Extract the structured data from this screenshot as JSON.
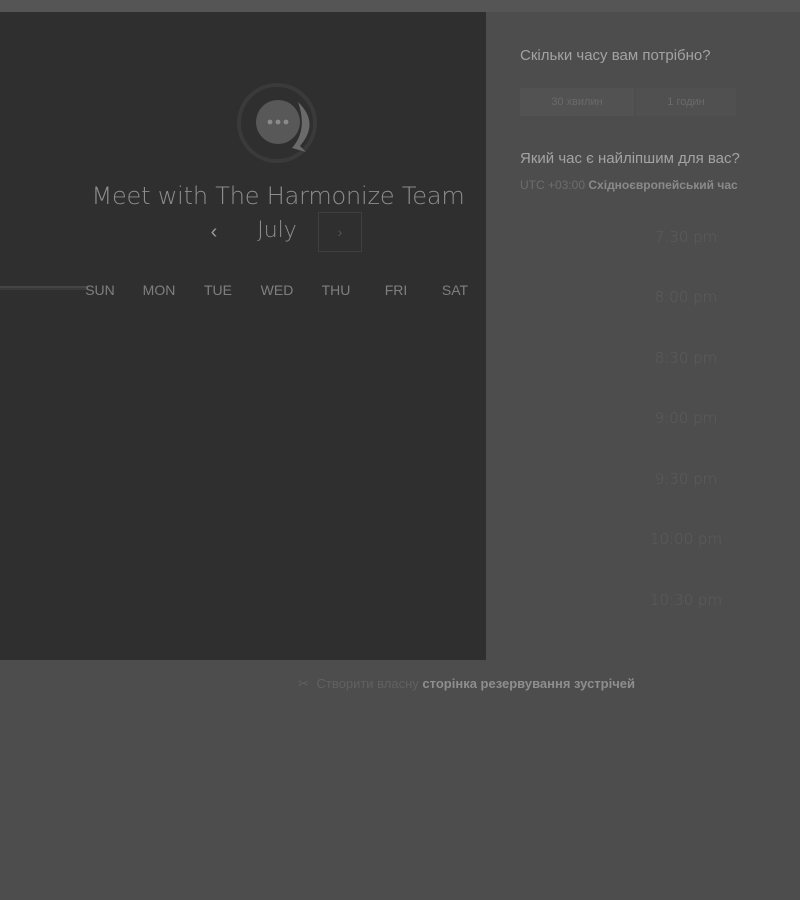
{
  "colors": {
    "background": "#4d4d4d",
    "left_panel": "#2f2f2f",
    "logo_ring": "#3a3a3a",
    "logo_bubble": "#5a5a5a",
    "text_muted": "#8e8e8e"
  },
  "calendar": {
    "title": "Meet with The Harmonize Team",
    "month": "July",
    "prev_icon": "‹",
    "next_icon": "›",
    "weekdays": [
      "SUN",
      "MON",
      "TUE",
      "WED",
      "THU",
      "FRI",
      "SAT"
    ]
  },
  "duration": {
    "question": "Скільки часу вам потрібно?",
    "options": [
      "30 хвилин",
      "1 годин"
    ]
  },
  "time": {
    "question": "Який час є найліпшим для вас?",
    "tz_offset": "UTC +03:00",
    "tz_name": "Східноєвропейський час",
    "slots": [
      "7:30 pm",
      "8:00 pm",
      "8:30 pm",
      "9:00 pm",
      "9:30 pm",
      "10:00 pm",
      "10:30 pm"
    ]
  },
  "footer": {
    "icon": "✂",
    "text": "Створити власну",
    "link": "сторінка резервування зустрічей"
  }
}
